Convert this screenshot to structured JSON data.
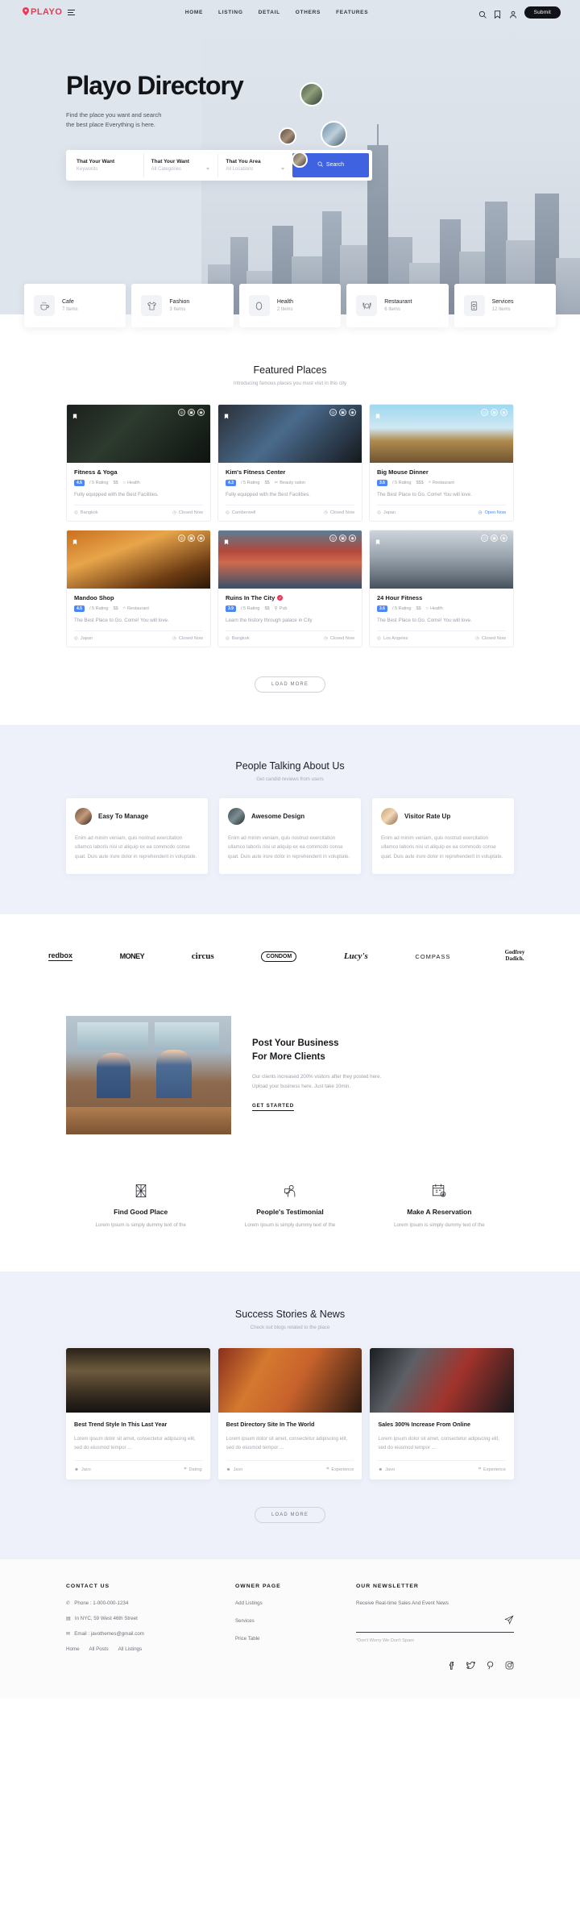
{
  "header": {
    "logo_text": "PLAYO",
    "nav": [
      {
        "label": "HOME"
      },
      {
        "label": "LISTING"
      },
      {
        "label": "DETAIL"
      },
      {
        "label": "OTHERS"
      },
      {
        "label": "FEATURES"
      }
    ],
    "submit_label": "Submit",
    "icons": [
      "search-icon",
      "bookmark-icon",
      "user-icon"
    ]
  },
  "hero": {
    "title": "Playo Directory",
    "subtitle_line1": "Find the place you want and search",
    "subtitle_line2": "the best place Everything is here.",
    "search": {
      "field1_label": "That Your Want",
      "field1_value": "Keywords",
      "field2_label": "That Your Want",
      "field2_value": "All Categories",
      "field3_label": "That You Area",
      "field3_value": "All Locations",
      "button_label": "Search"
    }
  },
  "categories": [
    {
      "name": "Cafe",
      "items": "7 Items",
      "icon": "coffee-cup-icon"
    },
    {
      "name": "Fashion",
      "items": "3 Items",
      "icon": "tshirt-icon"
    },
    {
      "name": "Health",
      "items": "2 Items",
      "icon": "pill-icon"
    },
    {
      "name": "Restaurant",
      "items": "6 Items",
      "icon": "cutlery-icon"
    },
    {
      "name": "Services",
      "items": "12 Items",
      "icon": "device-icon"
    }
  ],
  "featured": {
    "title": "Featured Places",
    "subtitle": "Introducing famous places you must visit in this city",
    "load_more": "LOAD MORE",
    "cards": [
      {
        "title": "Fitness & Yoga",
        "verified": false,
        "rating": "4.6",
        "rating_suffix": "/ 5 Rating",
        "price": "$$",
        "category": "Health",
        "desc": "Fully equipped with the Best Facilities.",
        "location": "Bangkok",
        "status": "Closed Now",
        "open": false
      },
      {
        "title": "Kim's Fitness Center",
        "verified": false,
        "rating": "4.3",
        "rating_suffix": "/ 5 Rating",
        "price": "$$",
        "category": "Beauty salon",
        "desc": "Fully equipped with the Best Facilities.",
        "location": "Camberwell",
        "status": "Closed Now",
        "open": false
      },
      {
        "title": "Big Mouse Dinner",
        "verified": false,
        "rating": "3.6",
        "rating_suffix": "/ 5 Rating",
        "price": "$$$",
        "category": "Restaurant",
        "desc": "The Best Place to Go. Come! You will love.",
        "location": "Japan",
        "status": "Open Now",
        "open": true
      },
      {
        "title": "Mandoo Shop",
        "verified": false,
        "rating": "4.5",
        "rating_suffix": "/ 5 Rating",
        "price": "$$",
        "category": "Restaurant",
        "desc": "The Best Place to Go. Come! You will love.",
        "location": "Japan",
        "status": "Closed Now",
        "open": false
      },
      {
        "title": "Ruins In The City",
        "verified": true,
        "rating": "3.9",
        "rating_suffix": "/ 5 Rating",
        "price": "$$",
        "category": "Pub",
        "desc": "Learn the history through palace in City",
        "location": "Bangkok",
        "status": "Closed Now",
        "open": false
      },
      {
        "title": "24 Hour Fitness",
        "verified": false,
        "rating": "3.6",
        "rating_suffix": "/ 5 Rating",
        "price": "$$",
        "category": "Health",
        "desc": "The Best Place to Go. Come! You will love.",
        "location": "Los Angeles",
        "status": "Closed Now",
        "open": false
      }
    ]
  },
  "testimonials": {
    "title": "People Talking About Us",
    "subtitle": "Get candid reviews from users",
    "body": "Enim ad minim veniam, quis nostrud exercitation ullamco laboris nisi ut aliquip ex ea commodo conse quat. Duis aute irure dolor in reprehenderit in voluptate.",
    "items": [
      {
        "name": "Easy To Manage"
      },
      {
        "name": "Awesome Design"
      },
      {
        "name": "Visitor Rate Up"
      }
    ]
  },
  "brands": [
    {
      "name": "redbox"
    },
    {
      "name": "MONEY"
    },
    {
      "name": "circus"
    },
    {
      "name": "CONDOM"
    },
    {
      "name": "Lucy's"
    },
    {
      "name": "COMPASS"
    },
    {
      "name": "Godfrey Dadich."
    }
  ],
  "promo": {
    "title_line1": "Post Your Business",
    "title_line2": "For More Clients",
    "text_line1": "Our clients increased 200% visitors after they posted here.",
    "text_line2": "Upload your business here. Just take 10min.",
    "link": "GET STARTED"
  },
  "features": [
    {
      "title": "Find Good Place",
      "sub": "Lorem Ipsum is simply dummy text of the",
      "icon": "map-icon"
    },
    {
      "title": "People's Testimonial",
      "sub": "Lorem Ipsum is simply dummy text of the",
      "icon": "testimonial-icon"
    },
    {
      "title": "Make A Reservation",
      "sub": "Lorem Ipsum is simply dummy text of the",
      "icon": "calendar-icon"
    }
  ],
  "blog": {
    "title": "Success Stories & News",
    "subtitle": "Check out blogs related to the place",
    "load_more": "LOAD MORE",
    "posts": [
      {
        "title": "Best Trend Style In This Last Year",
        "excerpt": "Lorem ipsum dolor sit amet, consectetur adipiscing elit, sed do eiusmod tempor ...",
        "author": "Javo",
        "tag": "Dating"
      },
      {
        "title": "Best Directory Site In The World",
        "excerpt": "Lorem ipsum dolor sit amet, consectetur adipiscing elit, sed do eiusmod tempor ...",
        "author": "Javo",
        "tag": "Experience"
      },
      {
        "title": "Sales 300% Increase From Online",
        "excerpt": "Lorem ipsum dolor sit amet, consectetur adipiscing elit, sed do eiusmod tempor ...",
        "author": "Javo",
        "tag": "Experience"
      }
    ]
  },
  "footer": {
    "contact_head": "CONTACT US",
    "phone": "Phone : 1-000-000-1234",
    "address": "In NYC, 59 West 46th Street",
    "email": "Email : javothemes@gmail.com",
    "bottom_links": [
      {
        "label": "Home"
      },
      {
        "label": "All Posts"
      },
      {
        "label": "All Listings"
      }
    ],
    "owner_head": "OWNER PAGE",
    "owner_links": [
      {
        "label": "Add Listings"
      },
      {
        "label": "Services"
      },
      {
        "label": "Price Table"
      }
    ],
    "news_head": "OUR NEWSLETTER",
    "news_desc": "Receive Real-time Sales And Event News",
    "news_placeholder": "",
    "news_note": "*Don't Worry We Don't Spam",
    "socials": [
      "facebook-icon",
      "twitter-icon",
      "pinterest-icon",
      "instagram-icon"
    ]
  },
  "colors": {
    "brand_red": "#ef3551",
    "accent_blue": "#3e62e0",
    "rating_blue": "#4f86f7",
    "hero_bg": "#dfe5ec",
    "band_bg": "#eef1f9"
  }
}
